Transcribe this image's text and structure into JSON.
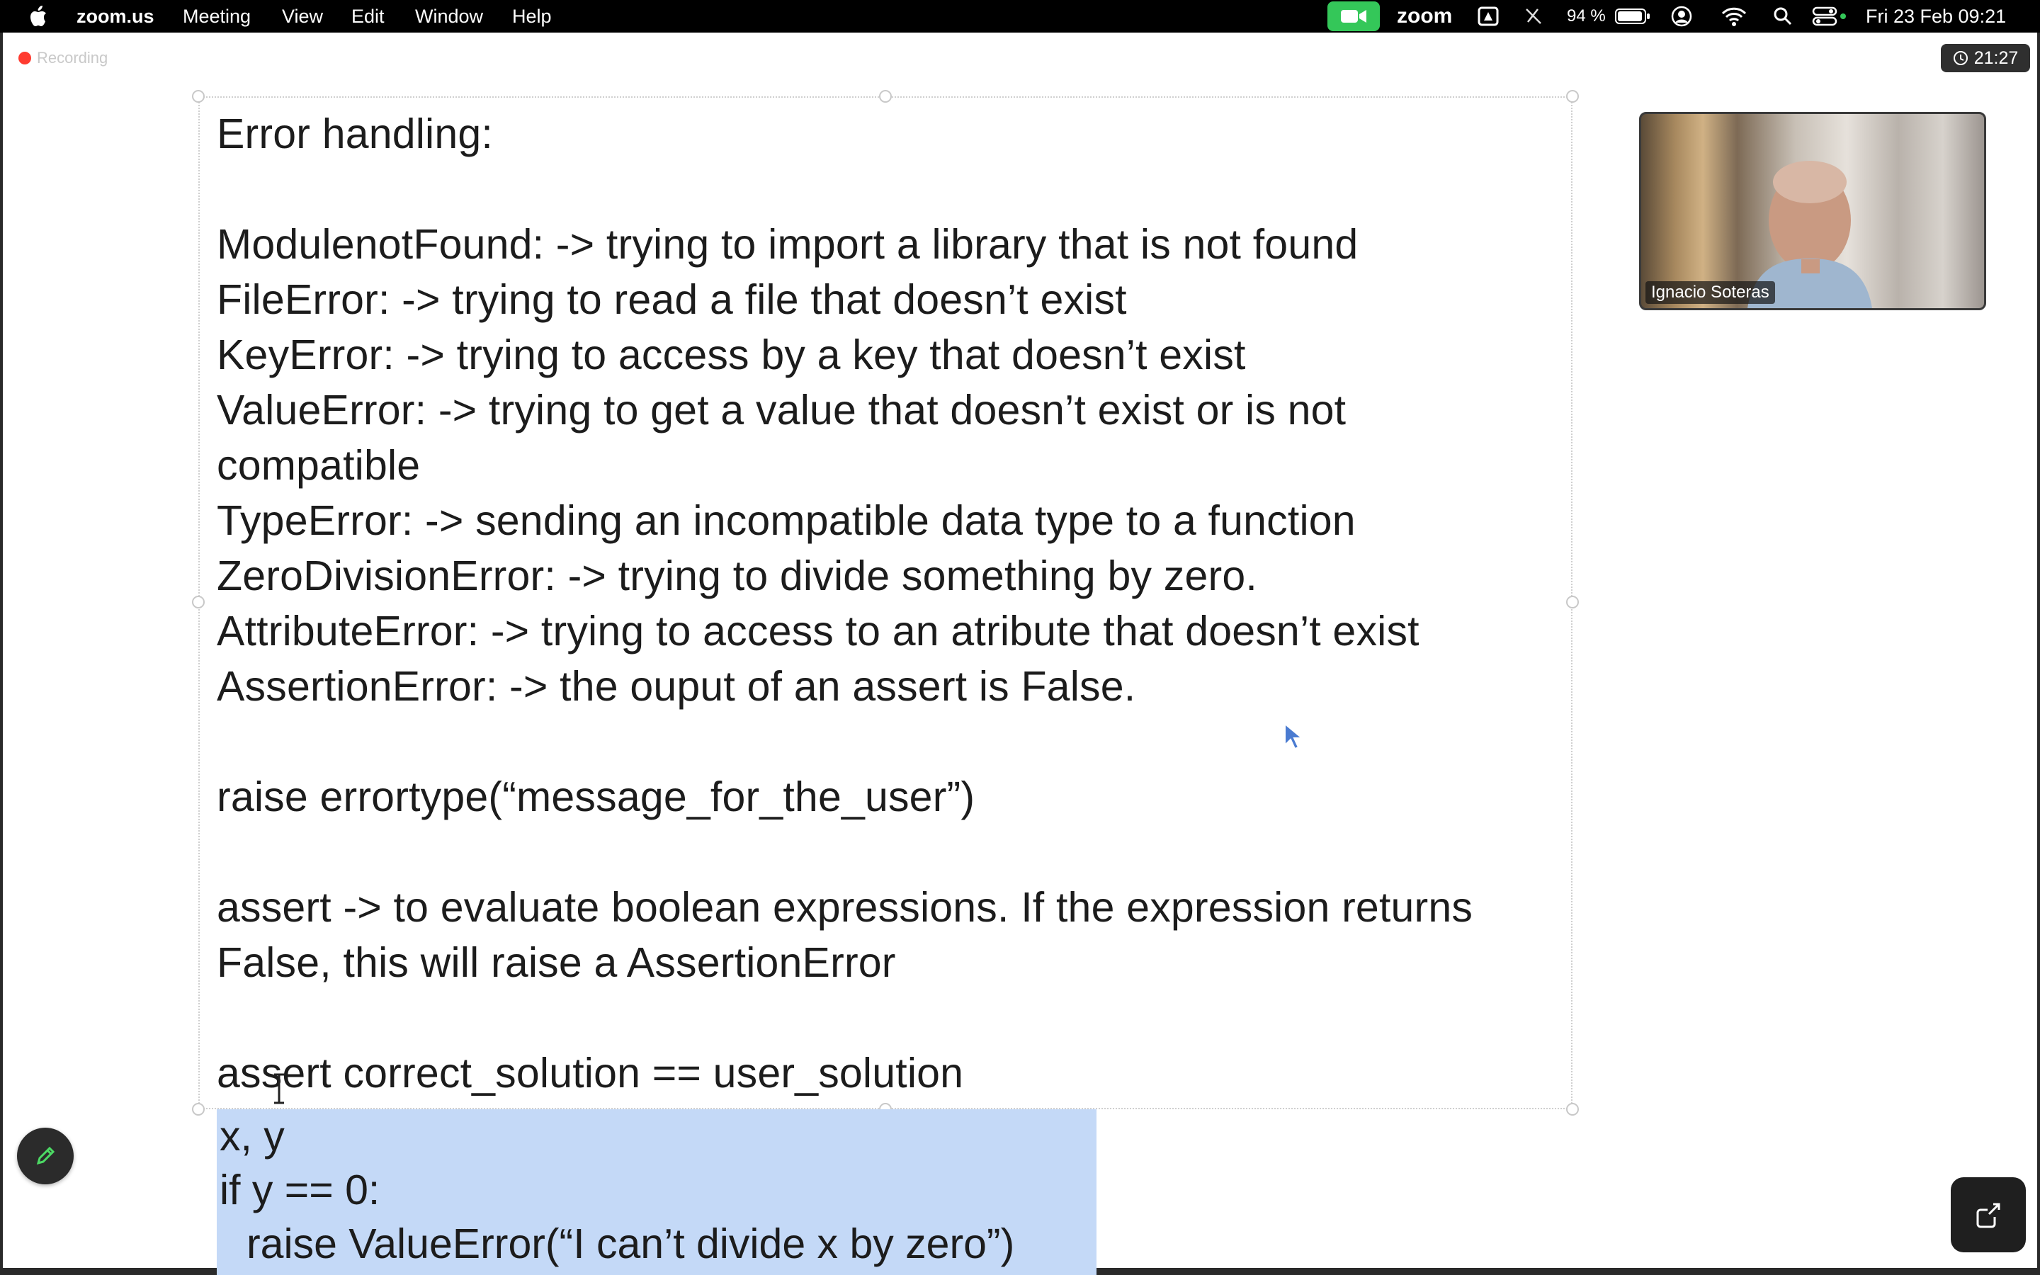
{
  "menubar": {
    "app_name": "zoom.us",
    "menus": [
      "Meeting",
      "View",
      "Edit",
      "Window",
      "Help"
    ],
    "zoom_label": "zoom",
    "battery": "94 %",
    "datetime": "Fri 23 Feb  09:21"
  },
  "recording": {
    "label": "Recording"
  },
  "timer": {
    "label": "21:27"
  },
  "slide": {
    "lines": [
      "Error handling:",
      "",
      "ModulenotFound: -> trying to import a library that is not found",
      "FileError: -> trying to read a file that doesn’t exist",
      "KeyError: -> trying to access by a key that doesn’t exist",
      "ValueError: -> trying to get a value that doesn’t exist or is not",
      "compatible",
      "TypeError: -> sending an incompatible data type to a function",
      "ZeroDivisionError: -> trying to divide something by zero.",
      "AttributeError: -> trying to access to an atribute that doesn’t exist",
      "AssertionError: -> the ouput of an assert is False.",
      "",
      "raise errortype(“message_for_the_user”)",
      "",
      "assert -> to evaluate boolean expressions. If the expression returns",
      "False, this will raise a AssertionError",
      "",
      "assert correct_solution == user_solution"
    ],
    "code_lines": [
      "x, y",
      "if y == 0:",
      "   raise ValueError(“I can’t divide x by zero”)"
    ]
  },
  "video": {
    "participant_name": "Ignacio Soteras"
  },
  "icons": {
    "apple": "apple-logo-icon",
    "camera": "zoom-camera-icon",
    "annotate": "pencil-icon",
    "share": "share-icon",
    "clock": "clock-icon"
  },
  "colors": {
    "menubar": "#000000",
    "zoom_green": "#34c759",
    "recording_red": "#ff3b30",
    "selection": "#c4d9f7",
    "annotate_pencil": "#4cd964"
  }
}
